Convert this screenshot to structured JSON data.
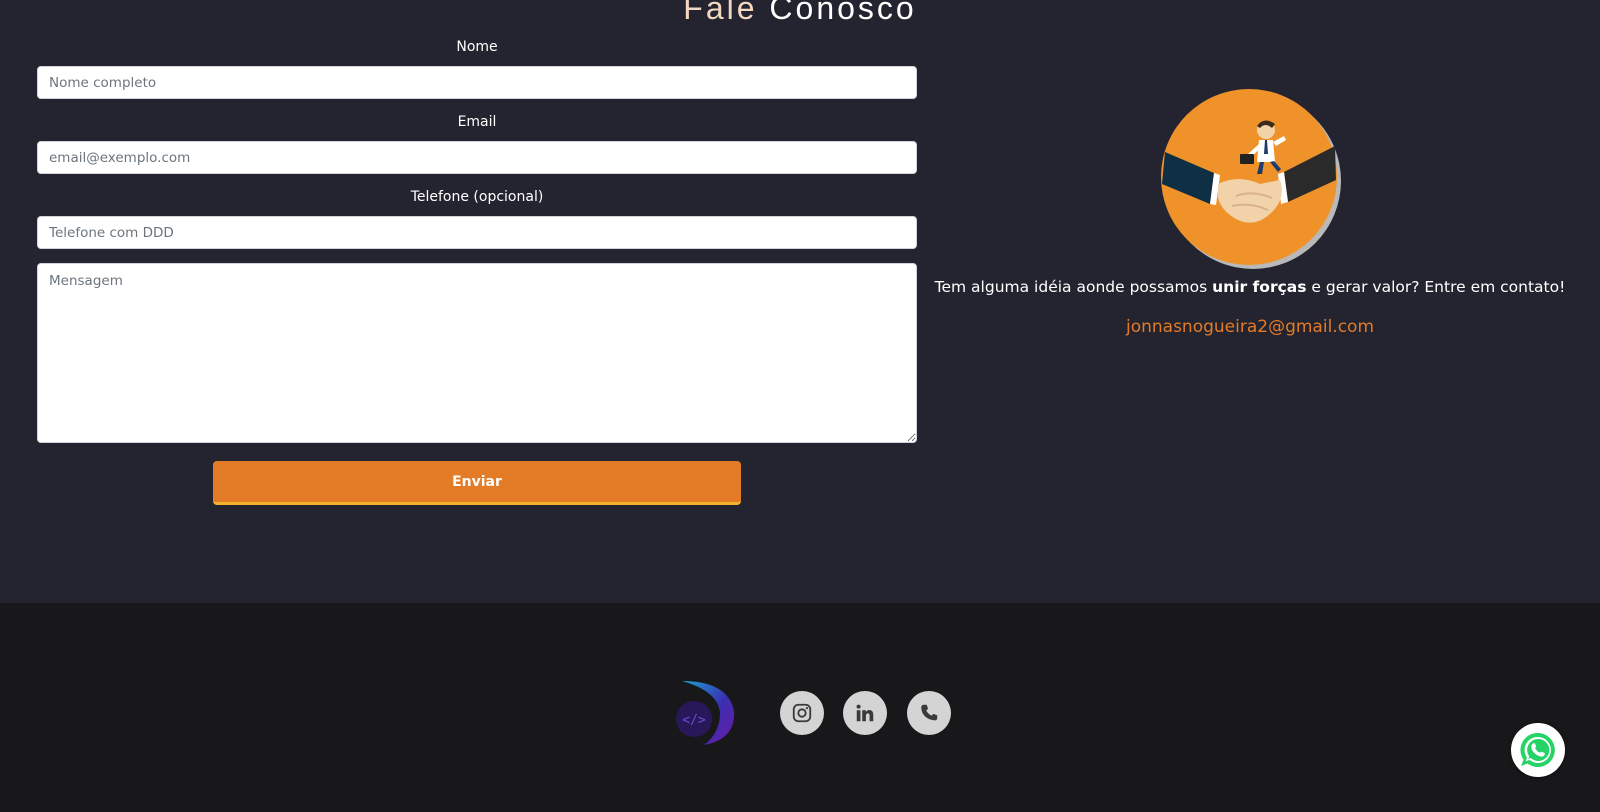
{
  "contact": {
    "title_prefix": "Fale",
    "title_accent": "Conosco",
    "form": {
      "name_label": "Nome",
      "name_placeholder": "Nome completo",
      "email_label": "Email",
      "email_placeholder": "email@exemplo.com",
      "phone_label": "Telefone (opcional)",
      "phone_placeholder": "Telefone com DDD",
      "message_placeholder": "Mensagem",
      "submit_label": "Enviar"
    },
    "cta": {
      "text_before": "Tem alguma idéia aonde possamos ",
      "text_bold": "unir forças",
      "text_after": " e gerar valor? Entre em contato!",
      "email": "jonnasnogueira2@gmail.com"
    }
  },
  "footer": {
    "social": [
      {
        "icon": "instagram-icon"
      },
      {
        "icon": "linkedin-icon"
      },
      {
        "icon": "phone-icon"
      }
    ]
  },
  "whatsapp": {
    "icon": "whatsapp-icon"
  },
  "colors": {
    "background": "#23242f",
    "footer_background": "#18181a",
    "accent": "#e37b27",
    "button_border": "#f2b12b",
    "title": "#f2d7c1"
  }
}
